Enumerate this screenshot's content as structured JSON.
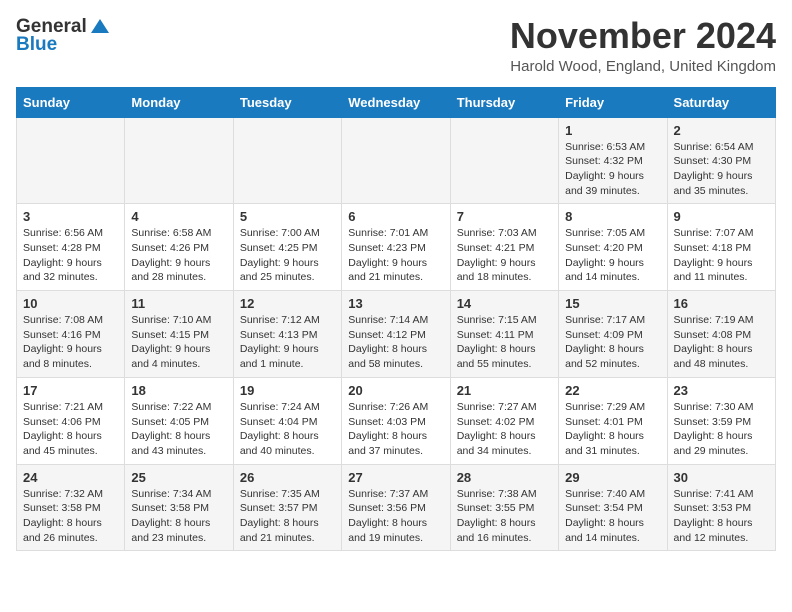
{
  "logo": {
    "general": "General",
    "blue": "Blue"
  },
  "title": "November 2024",
  "location": "Harold Wood, England, United Kingdom",
  "days_header": [
    "Sunday",
    "Monday",
    "Tuesday",
    "Wednesday",
    "Thursday",
    "Friday",
    "Saturday"
  ],
  "weeks": [
    [
      {
        "day": "",
        "info": ""
      },
      {
        "day": "",
        "info": ""
      },
      {
        "day": "",
        "info": ""
      },
      {
        "day": "",
        "info": ""
      },
      {
        "day": "",
        "info": ""
      },
      {
        "day": "1",
        "info": "Sunrise: 6:53 AM\nSunset: 4:32 PM\nDaylight: 9 hours and 39 minutes."
      },
      {
        "day": "2",
        "info": "Sunrise: 6:54 AM\nSunset: 4:30 PM\nDaylight: 9 hours and 35 minutes."
      }
    ],
    [
      {
        "day": "3",
        "info": "Sunrise: 6:56 AM\nSunset: 4:28 PM\nDaylight: 9 hours and 32 minutes."
      },
      {
        "day": "4",
        "info": "Sunrise: 6:58 AM\nSunset: 4:26 PM\nDaylight: 9 hours and 28 minutes."
      },
      {
        "day": "5",
        "info": "Sunrise: 7:00 AM\nSunset: 4:25 PM\nDaylight: 9 hours and 25 minutes."
      },
      {
        "day": "6",
        "info": "Sunrise: 7:01 AM\nSunset: 4:23 PM\nDaylight: 9 hours and 21 minutes."
      },
      {
        "day": "7",
        "info": "Sunrise: 7:03 AM\nSunset: 4:21 PM\nDaylight: 9 hours and 18 minutes."
      },
      {
        "day": "8",
        "info": "Sunrise: 7:05 AM\nSunset: 4:20 PM\nDaylight: 9 hours and 14 minutes."
      },
      {
        "day": "9",
        "info": "Sunrise: 7:07 AM\nSunset: 4:18 PM\nDaylight: 9 hours and 11 minutes."
      }
    ],
    [
      {
        "day": "10",
        "info": "Sunrise: 7:08 AM\nSunset: 4:16 PM\nDaylight: 9 hours and 8 minutes."
      },
      {
        "day": "11",
        "info": "Sunrise: 7:10 AM\nSunset: 4:15 PM\nDaylight: 9 hours and 4 minutes."
      },
      {
        "day": "12",
        "info": "Sunrise: 7:12 AM\nSunset: 4:13 PM\nDaylight: 9 hours and 1 minute."
      },
      {
        "day": "13",
        "info": "Sunrise: 7:14 AM\nSunset: 4:12 PM\nDaylight: 8 hours and 58 minutes."
      },
      {
        "day": "14",
        "info": "Sunrise: 7:15 AM\nSunset: 4:11 PM\nDaylight: 8 hours and 55 minutes."
      },
      {
        "day": "15",
        "info": "Sunrise: 7:17 AM\nSunset: 4:09 PM\nDaylight: 8 hours and 52 minutes."
      },
      {
        "day": "16",
        "info": "Sunrise: 7:19 AM\nSunset: 4:08 PM\nDaylight: 8 hours and 48 minutes."
      }
    ],
    [
      {
        "day": "17",
        "info": "Sunrise: 7:21 AM\nSunset: 4:06 PM\nDaylight: 8 hours and 45 minutes."
      },
      {
        "day": "18",
        "info": "Sunrise: 7:22 AM\nSunset: 4:05 PM\nDaylight: 8 hours and 43 minutes."
      },
      {
        "day": "19",
        "info": "Sunrise: 7:24 AM\nSunset: 4:04 PM\nDaylight: 8 hours and 40 minutes."
      },
      {
        "day": "20",
        "info": "Sunrise: 7:26 AM\nSunset: 4:03 PM\nDaylight: 8 hours and 37 minutes."
      },
      {
        "day": "21",
        "info": "Sunrise: 7:27 AM\nSunset: 4:02 PM\nDaylight: 8 hours and 34 minutes."
      },
      {
        "day": "22",
        "info": "Sunrise: 7:29 AM\nSunset: 4:01 PM\nDaylight: 8 hours and 31 minutes."
      },
      {
        "day": "23",
        "info": "Sunrise: 7:30 AM\nSunset: 3:59 PM\nDaylight: 8 hours and 29 minutes."
      }
    ],
    [
      {
        "day": "24",
        "info": "Sunrise: 7:32 AM\nSunset: 3:58 PM\nDaylight: 8 hours and 26 minutes."
      },
      {
        "day": "25",
        "info": "Sunrise: 7:34 AM\nSunset: 3:58 PM\nDaylight: 8 hours and 23 minutes."
      },
      {
        "day": "26",
        "info": "Sunrise: 7:35 AM\nSunset: 3:57 PM\nDaylight: 8 hours and 21 minutes."
      },
      {
        "day": "27",
        "info": "Sunrise: 7:37 AM\nSunset: 3:56 PM\nDaylight: 8 hours and 19 minutes."
      },
      {
        "day": "28",
        "info": "Sunrise: 7:38 AM\nSunset: 3:55 PM\nDaylight: 8 hours and 16 minutes."
      },
      {
        "day": "29",
        "info": "Sunrise: 7:40 AM\nSunset: 3:54 PM\nDaylight: 8 hours and 14 minutes."
      },
      {
        "day": "30",
        "info": "Sunrise: 7:41 AM\nSunset: 3:53 PM\nDaylight: 8 hours and 12 minutes."
      }
    ]
  ]
}
